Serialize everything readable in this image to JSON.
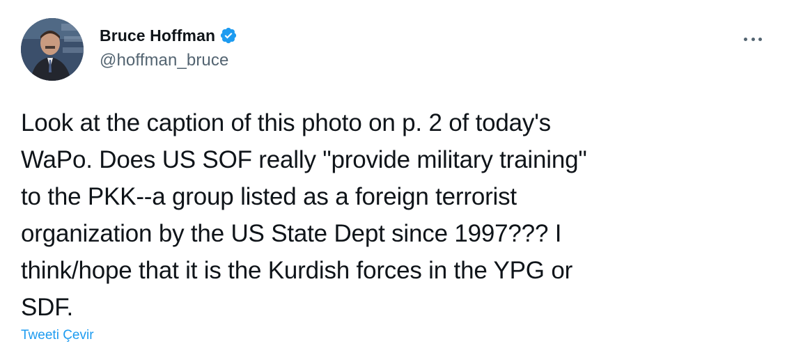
{
  "tweet": {
    "author": {
      "display_name": "Bruce Hoffman",
      "handle": "@hoffman_bruce",
      "verified": true
    },
    "text": "Look at the caption of this photo on p. 2 of today's\nWaPo. Does US SOF really \"provide military training\"\nto the PKK--a group listed as a foreign terrorist\norganization by the US State Dept since 1997??? I\nthink/hope that it is the Kurdish forces in the YPG or\nSDF.",
    "translate_label": "Tweeti Çevir"
  },
  "icons": {
    "verified": "verified-badge-icon",
    "more": "more-options-icon"
  },
  "colors": {
    "accent": "#1d9bf0",
    "text_primary": "#0f1419",
    "text_secondary": "#536471"
  }
}
